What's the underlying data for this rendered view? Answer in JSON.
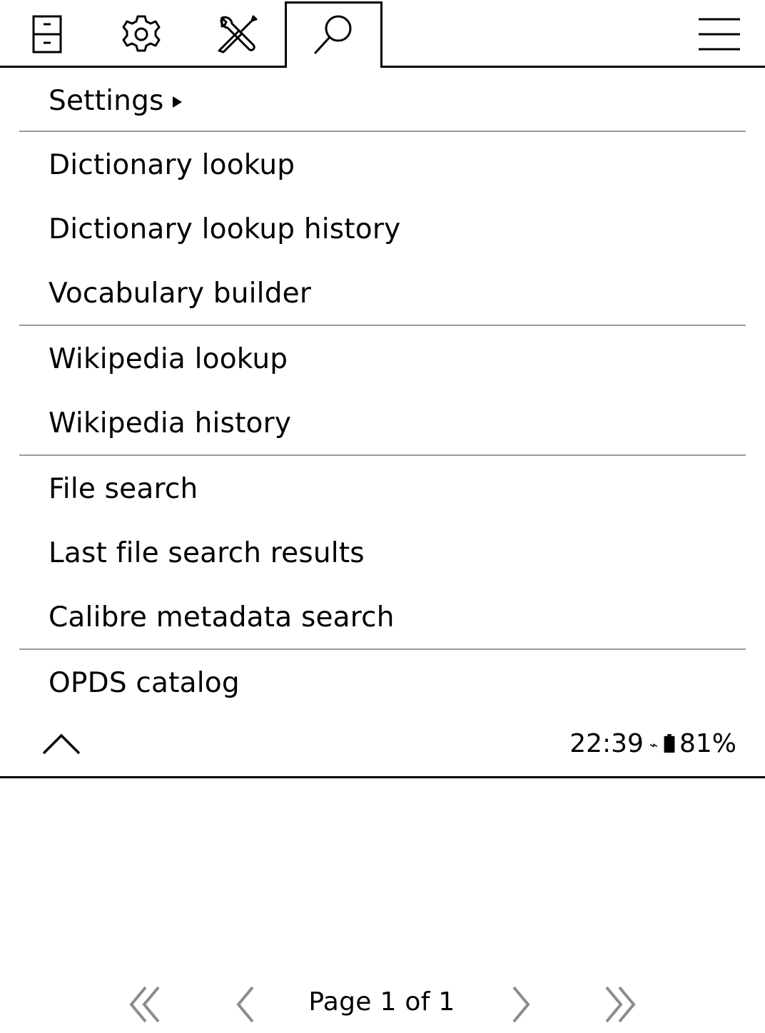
{
  "tabs": [
    {
      "name": "file-cabinet-icon"
    },
    {
      "name": "gear-icon"
    },
    {
      "name": "tools-icon"
    },
    {
      "name": "search-icon",
      "active": true
    },
    {
      "name": "hamburger-menu-icon"
    }
  ],
  "menu": {
    "settings": "Settings",
    "items": [
      "Dictionary lookup",
      "Dictionary lookup history",
      "Vocabulary builder",
      "Wikipedia lookup",
      "Wikipedia history",
      "File search",
      "Last file search results",
      "Calibre metadata search",
      "OPDS catalog"
    ]
  },
  "status": {
    "time": "22:39",
    "charging_glyph": "⌁",
    "battery": "81%"
  },
  "pager": {
    "label": "Page 1 of 1"
  },
  "colors": {
    "separator": "#9a9a9a",
    "pager_arrows": "#8c8c8c",
    "text": "#000000"
  }
}
